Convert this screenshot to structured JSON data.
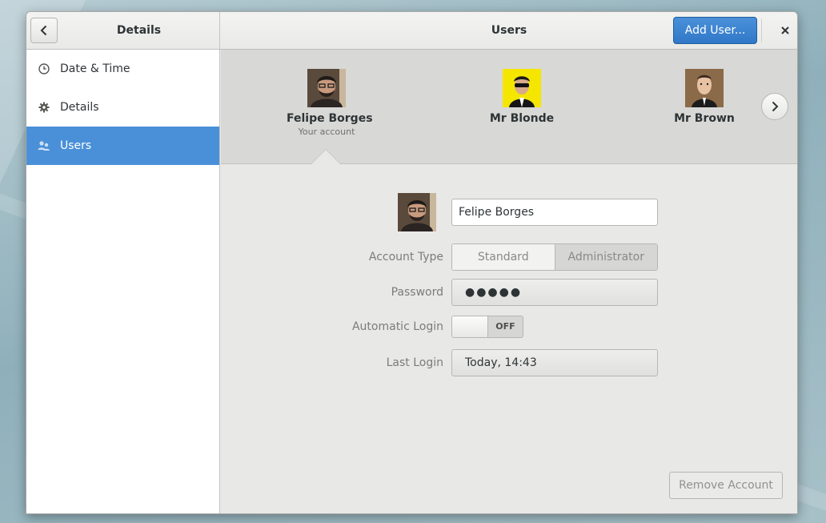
{
  "sidebar_header": {
    "title": "Details"
  },
  "header": {
    "title": "Users",
    "add_user_label": "Add User..."
  },
  "sidebar": {
    "items": [
      {
        "label": "Date & Time",
        "icon": "clock-icon",
        "active": false
      },
      {
        "label": "Details",
        "icon": "gear-icon",
        "active": false
      },
      {
        "label": "Users",
        "icon": "users-icon",
        "active": true
      }
    ]
  },
  "carousel": {
    "users": [
      {
        "name": "Felipe Borges",
        "subtitle": "Your account"
      },
      {
        "name": "Mr Blonde",
        "subtitle": ""
      },
      {
        "name": "Mr Brown",
        "subtitle": ""
      }
    ]
  },
  "form": {
    "full_name": "Felipe Borges",
    "account_type_label": "Account Type",
    "account_type_options": [
      "Standard",
      "Administrator"
    ],
    "password_label": "Password",
    "password_value": "●●●●●",
    "autologin_label": "Automatic Login",
    "autologin_state": "OFF",
    "last_login_label": "Last Login",
    "last_login_value": "Today, 14:43"
  },
  "actions": {
    "remove_label": "Remove Account"
  },
  "colors": {
    "accent": "#4a90d9",
    "background": "#e8e8e7",
    "sidebar": "#ffffff"
  }
}
